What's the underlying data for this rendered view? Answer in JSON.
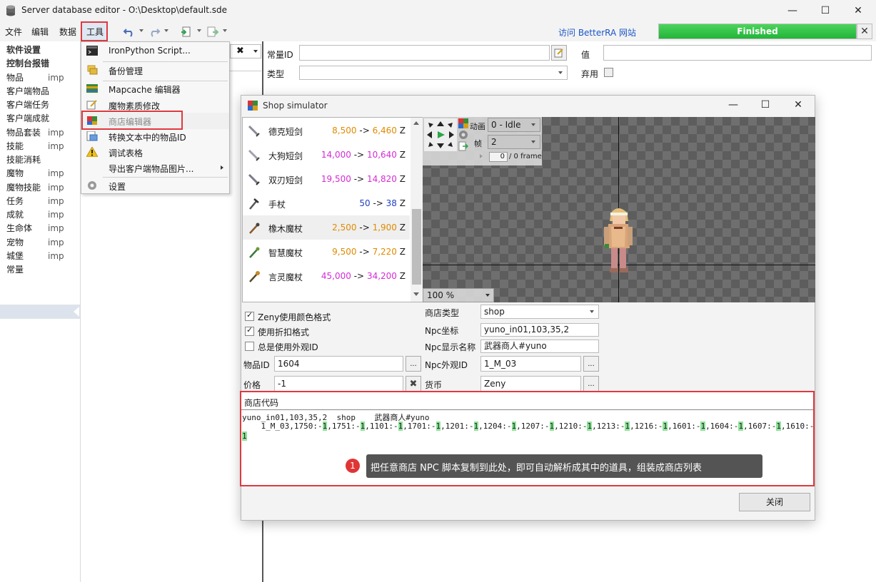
{
  "window": {
    "title": "Server database editor - O:\\Desktop\\default.sde",
    "minimize": "—",
    "maximize": "☐",
    "close": "✕"
  },
  "menu": {
    "file": "文件",
    "edit": "编辑",
    "data": "数据",
    "tools": "工具"
  },
  "toolbar": {
    "link": "访问 BetterRA 网站",
    "progress": "Finished",
    "progress_close": "✕"
  },
  "sidebar": {
    "items": [
      {
        "label": "软件设置",
        "tag": "",
        "bold": true
      },
      {
        "label": "控制台报错",
        "tag": "",
        "bold": true
      },
      {
        "label": "物品",
        "tag": "imp"
      },
      {
        "label": "客户端物品",
        "tag": ""
      },
      {
        "label": "客户端任务",
        "tag": ""
      },
      {
        "label": "客户端成就",
        "tag": ""
      },
      {
        "label": "物品套装",
        "tag": "imp"
      },
      {
        "label": "技能",
        "tag": "imp"
      },
      {
        "label": "技能消耗",
        "tag": ""
      },
      {
        "label": "魔物",
        "tag": "imp"
      },
      {
        "label": "魔物技能",
        "tag": "imp"
      },
      {
        "label": "任务",
        "tag": "imp"
      },
      {
        "label": "成就",
        "tag": "imp"
      },
      {
        "label": "生命体",
        "tag": "imp"
      },
      {
        "label": "宠物",
        "tag": "imp"
      },
      {
        "label": "城堡",
        "tag": "imp"
      },
      {
        "label": "常量",
        "tag": ""
      }
    ]
  },
  "main": {
    "const_id_label": "常量ID",
    "const_id_value": "",
    "value_label": "值",
    "value_value": "",
    "type_label": "类型",
    "type_value": "",
    "deprecated_label": "弃用",
    "search_clear": "✖"
  },
  "tools_menu": {
    "items": [
      {
        "label": "IronPython Script...",
        "icon": "terminal-icon"
      },
      {
        "label": "备份管理",
        "icon": "backup-icon"
      },
      {
        "label": "Mapcache 编辑器",
        "icon": "map-icon"
      },
      {
        "label": "魔物素质修改",
        "icon": "edit-icon"
      },
      {
        "label": "商店编辑器",
        "icon": "shop-icon"
      },
      {
        "label": "转换文本中的物品ID",
        "icon": "convert-icon"
      },
      {
        "label": "调试表格",
        "icon": "warning-icon"
      },
      {
        "label": "导出客户端物品图片...",
        "icon": ""
      },
      {
        "label": "设置",
        "icon": "gear-icon"
      }
    ]
  },
  "shop": {
    "title": "Shop simulator",
    "items": [
      {
        "name": "德克短剑",
        "price": "8,500",
        "discount": "6,460",
        "color": "#e08a00"
      },
      {
        "name": "大狗短剑",
        "price": "14,000",
        "discount": "10,640",
        "color": "#d42bd4"
      },
      {
        "name": "双刃短剑",
        "price": "19,500",
        "discount": "14,820",
        "color": "#d42bd4"
      },
      {
        "name": "手杖",
        "price": "50",
        "discount": "38",
        "color": "#1f3fbf"
      },
      {
        "name": "橡木魔杖",
        "price": "2,500",
        "discount": "1,900",
        "color": "#e08a00"
      },
      {
        "name": "智慧魔杖",
        "price": "9,500",
        "discount": "7,220",
        "color": "#e08a00"
      },
      {
        "name": "言灵魔杖",
        "price": "45,000",
        "discount": "34,200",
        "color": "#d42bd4"
      }
    ],
    "arrow": "->",
    "zeny": "Z",
    "anim_label": "动画",
    "anim_value": "0 - Idle",
    "frame_label": "帧",
    "frame_value": "2",
    "frame_counter": "0",
    "frame_total": "/ 0 frame",
    "zoom": "100 %",
    "opt_color": "Zeny使用颜色格式",
    "opt_discount": "使用折扣格式",
    "opt_viewid": "总是使用外观ID",
    "item_id_label": "物品ID",
    "item_id_value": "1604",
    "price_label": "价格",
    "price_value": "-1",
    "shop_type_label": "商店类型",
    "shop_type_value": "shop",
    "npc_coord_label": "Npc坐标",
    "npc_coord_value": "yuno_in01,103,35,2",
    "npc_name_label": "Npc显示名称",
    "npc_name_value": "武器商人#yuno",
    "npc_view_label": "Npc外观ID",
    "npc_view_value": "1_M_03",
    "currency_label": "货币",
    "currency_value": "Zeny",
    "ellipsis": "...",
    "code_header": "商店代码",
    "code_line1": "yuno_in01,103,35,2  shop    武器商人#yuno",
    "code_line2_prefix": "    1_M_03",
    "code_entries": [
      "1750",
      "1751",
      "1101",
      "1701",
      "1201",
      "1204",
      "1207",
      "1210",
      "1213",
      "1216",
      "1601",
      "1604",
      "1607",
      "1610"
    ],
    "code_value": "1",
    "callout_num": "1",
    "callout_text": "把任意商店 NPC 脚本复制到此处，即可自动解析成其中的道具，组装成商店列表",
    "close_button": "关闭"
  }
}
